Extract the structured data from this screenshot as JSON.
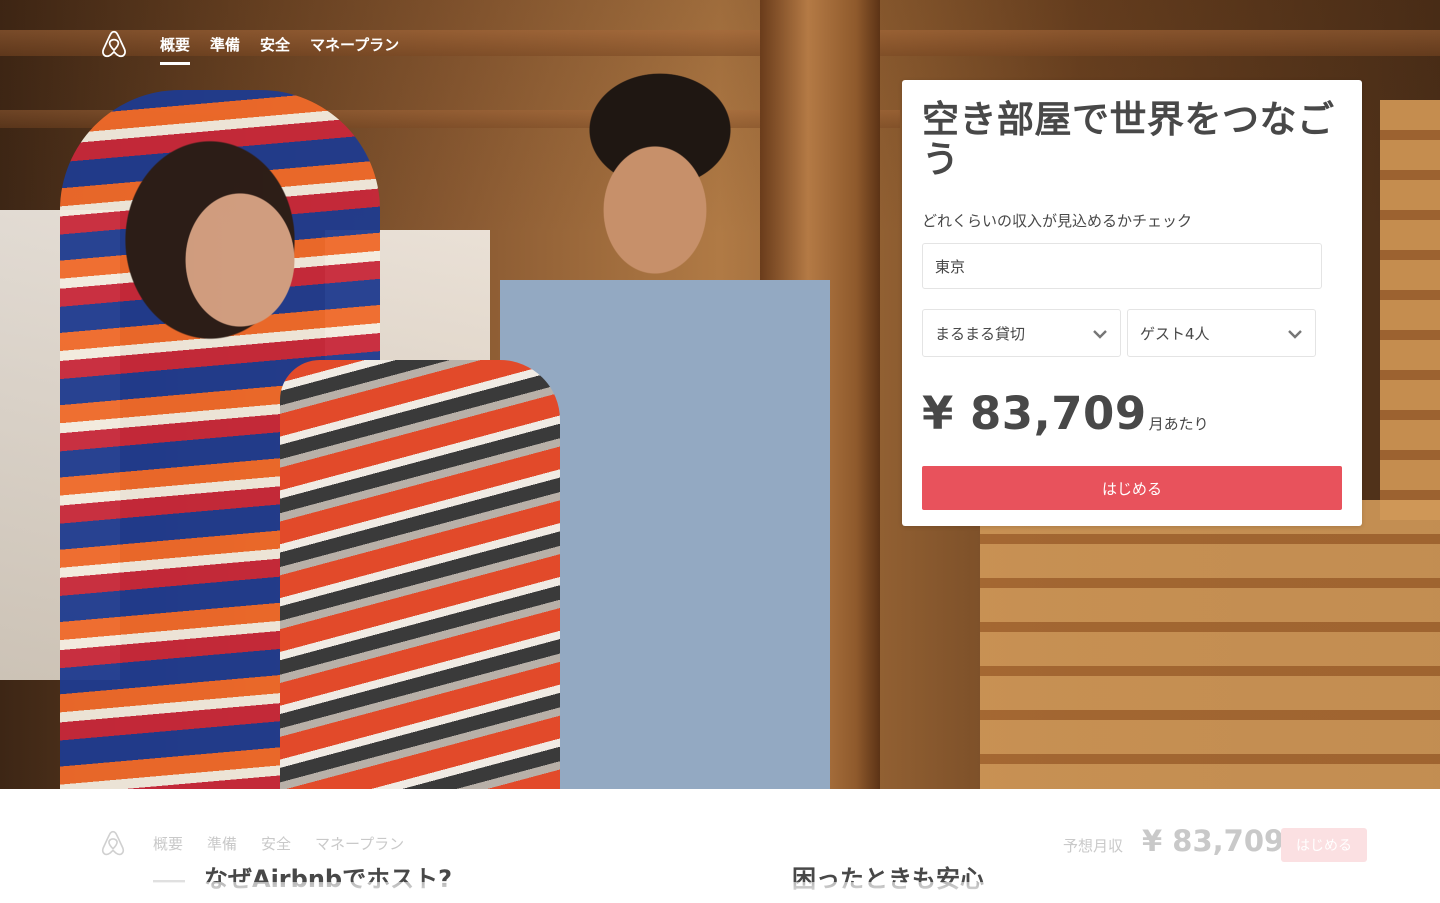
{
  "nav": {
    "logo": "airbnb-logo",
    "links": [
      {
        "label": "概要",
        "active": true
      },
      {
        "label": "準備",
        "active": false
      },
      {
        "label": "安全",
        "active": false
      },
      {
        "label": "マネープラン",
        "active": false
      }
    ]
  },
  "card": {
    "title": "空き部屋で世界をつなごう",
    "subtitle": "どれくらいの収入が見込めるかチェック",
    "location_value": "東京",
    "room_type": "まるまる貸切",
    "guests": "ゲスト4人",
    "price": "¥ 83,709",
    "price_unit": "月あたり",
    "cta_label": "はじめる"
  },
  "sticky": {
    "links": [
      "概要",
      "準備",
      "安全",
      "マネープラン"
    ],
    "estimate_label": "予想月収",
    "estimate_price": "¥ 83,709",
    "cta_label": "はじめる"
  },
  "sections": {
    "why_host": "なぜAirbnbでホスト?",
    "safety": "困ったときも安心"
  },
  "colors": {
    "accent": "#e8525c",
    "text": "#484848",
    "faded": "#c9c9c9"
  }
}
